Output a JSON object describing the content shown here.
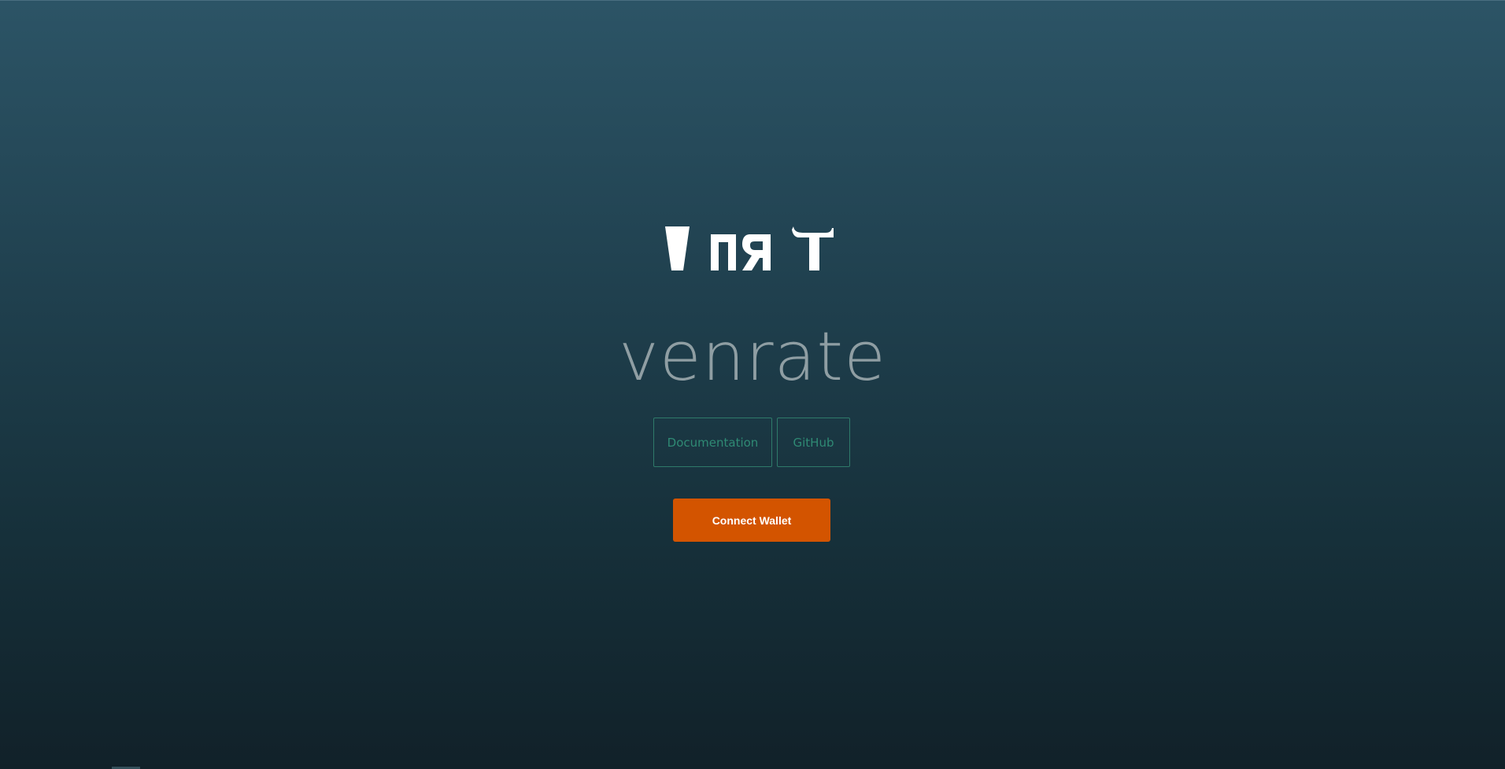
{
  "logo": {
    "icon": "venrate-logo-glyphs",
    "color": "#ffffff"
  },
  "hero": {
    "wordmark": "venrate"
  },
  "links": {
    "documentation_label": "Documentation",
    "github_label": "GitHub"
  },
  "actions": {
    "connect_wallet_label": "Connect Wallet"
  },
  "colors": {
    "accent": "#d35400",
    "link_border": "#2f7a6a",
    "wordmark": "#8f9ea3",
    "background_top": "#2c5466",
    "background_bottom": "#112129"
  }
}
